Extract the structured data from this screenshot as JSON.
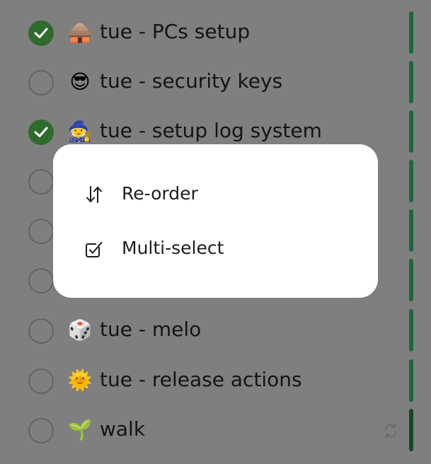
{
  "tasks": [
    {
      "title": "tue - PCs setup",
      "emoji": "🛖",
      "done": true
    },
    {
      "title": "tue - security keys",
      "emoji": "😎",
      "done": false
    },
    {
      "title": "tue - setup log system",
      "emoji": "🧙",
      "done": true
    },
    {
      "title": "",
      "emoji": "",
      "done": false
    },
    {
      "title": "",
      "emoji": "",
      "done": false
    },
    {
      "title": "",
      "emoji": "",
      "done": false
    },
    {
      "title": "tue - melo",
      "emoji": "🎲",
      "done": false
    },
    {
      "title": "tue - release actions",
      "emoji": "🌞",
      "done": false
    },
    {
      "title": "walk",
      "emoji": "🌱",
      "done": false,
      "repeat_icon": "repeat-icon"
    }
  ],
  "menu": {
    "items": [
      {
        "label": "Re-order",
        "icon": "reorder-icon"
      },
      {
        "label": "Multi-select",
        "icon": "multi-select-icon"
      }
    ]
  },
  "colors": {
    "overlay_background": "#7f7f7f",
    "done_check": "#2f6b2c",
    "progress_bar": "#196a3d",
    "popup_background": "#ffffff"
  }
}
